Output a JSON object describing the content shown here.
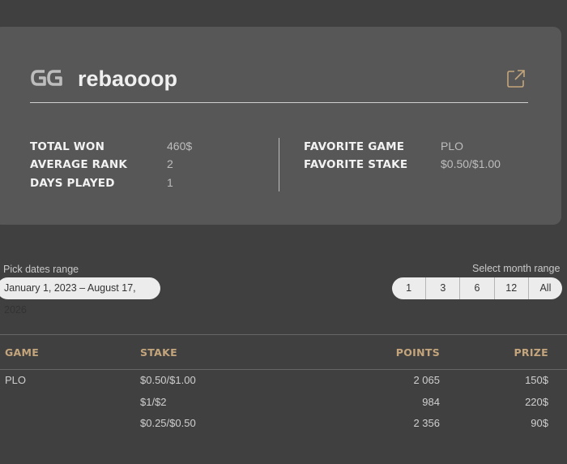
{
  "profile": {
    "username": "rebaooop",
    "logo_text": "GG",
    "logo_icon": "gg-logo-icon",
    "link_icon": "external-link-icon"
  },
  "stats": {
    "left": [
      {
        "label": "TOTAL WON",
        "value": "460$"
      },
      {
        "label": "AVERAGE RANK",
        "value": "2"
      },
      {
        "label": "DAYS PLAYED",
        "value": "1"
      }
    ],
    "right": [
      {
        "label": "FAVORITE GAME",
        "value": "PLO"
      },
      {
        "label": "FAVORITE STAKE",
        "value": "$0.50/$1.00"
      }
    ]
  },
  "filters": {
    "dates_label": "Pick dates range",
    "dates_value": "January 1, 2023 – August 17, 2026",
    "month_label": "Select month range",
    "month_options": [
      "1",
      "3",
      "6",
      "12",
      "All"
    ]
  },
  "table": {
    "headers": {
      "game": "GAME",
      "stake": "STAKE",
      "points": "POINTS",
      "prize": "PRIZE"
    },
    "rows": [
      {
        "game": "PLO",
        "stake": "$0.50/$1.00",
        "points": "2 065",
        "prize": "150$"
      },
      {
        "game": "",
        "stake": "$1/$2",
        "points": "984",
        "prize": "220$"
      },
      {
        "game": "",
        "stake": "$0.25/$0.50",
        "points": "2 356",
        "prize": "90$"
      }
    ]
  },
  "colors": {
    "background": "#404040",
    "card": "#575757",
    "header_accent": "#c4a57c",
    "pill": "#ececec"
  }
}
